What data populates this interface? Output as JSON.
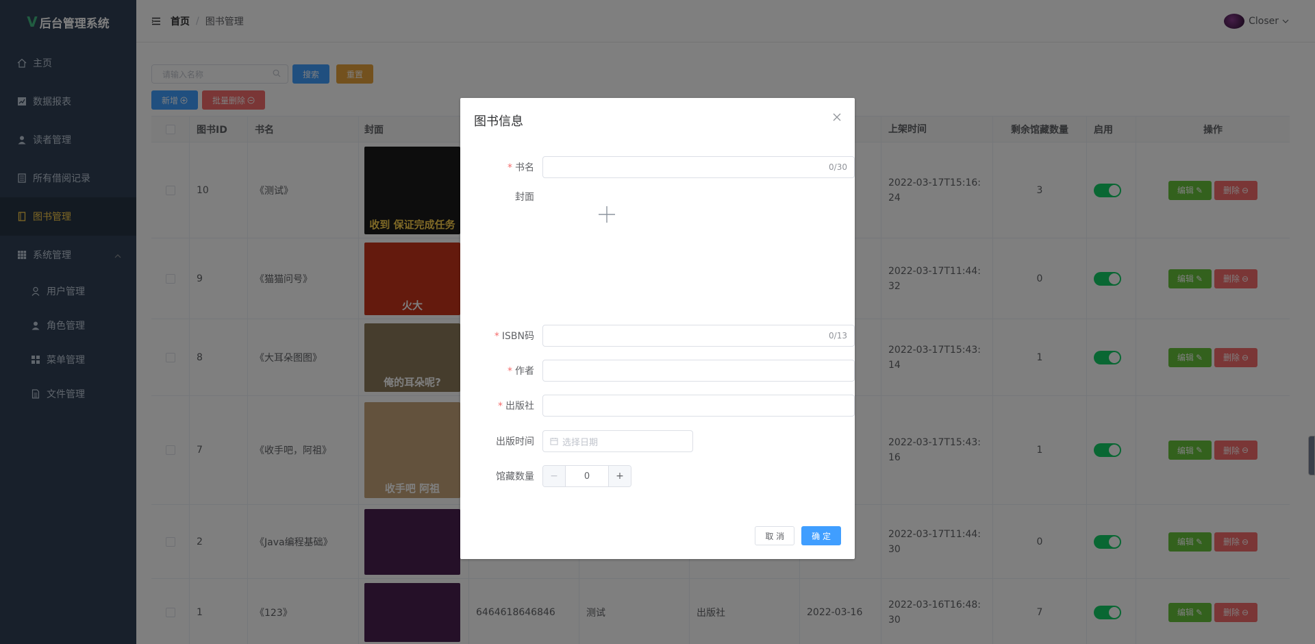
{
  "sidebar": {
    "logo": "后台管理系统",
    "items": [
      {
        "label": "主页",
        "icon": "home-icon"
      },
      {
        "label": "数据报表",
        "icon": "chart-icon"
      },
      {
        "label": "读者管理",
        "icon": "user-icon"
      },
      {
        "label": "所有借阅记录",
        "icon": "bank-icon"
      },
      {
        "label": "图书管理",
        "icon": "book-icon"
      },
      {
        "label": "系统管理",
        "icon": "grid-icon"
      }
    ],
    "subitems": [
      {
        "label": "用户管理",
        "icon": "user-icon"
      },
      {
        "label": "角色管理",
        "icon": "user-solid-icon"
      },
      {
        "label": "菜单管理",
        "icon": "menu-icon"
      },
      {
        "label": "文件管理",
        "icon": "document-icon"
      }
    ]
  },
  "header": {
    "breadcrumb_home": "首页",
    "breadcrumb_sep": "/",
    "breadcrumb_current": "图书管理",
    "username": "Closer"
  },
  "toolbar": {
    "search_placeholder": "请输入名称",
    "search_label": "搜索",
    "reset_label": "重置",
    "add_label": "新增",
    "batch_delete_label": "批量删除"
  },
  "table": {
    "headers": [
      "图书ID",
      "书名",
      "封面",
      "",
      "",
      "",
      "",
      "上架时间",
      "剩余馆藏数量",
      "启用",
      "操作"
    ],
    "rows": [
      {
        "id": "10",
        "name": "《测试》",
        "cover_text": "收到 保证完成任务",
        "isbn": "",
        "author": "",
        "publisher": "",
        "pubdate": "",
        "shelf": "2022-03-17T15:16:24",
        "remain": "3"
      },
      {
        "id": "9",
        "name": "《猫猫问号》",
        "cover_text": "火大",
        "isbn": "",
        "author": "",
        "publisher": "",
        "pubdate": "",
        "shelf": "2022-03-17T11:44:32",
        "remain": "0"
      },
      {
        "id": "8",
        "name": "《大耳朵图图》",
        "cover_text": "俺的耳朵呢?",
        "isbn": "",
        "author": "",
        "publisher": "",
        "pubdate": "",
        "shelf": "2022-03-17T15:43:14",
        "remain": "1"
      },
      {
        "id": "7",
        "name": "《收手吧，阿祖》",
        "cover_text": "收手吧 阿祖",
        "isbn": "",
        "author": "",
        "publisher": "",
        "pubdate": "",
        "shelf": "2022-03-17T15:43:16",
        "remain": "1"
      },
      {
        "id": "2",
        "name": "《Java编程基础》",
        "cover_text": "",
        "isbn": "",
        "author": "",
        "publisher": "",
        "pubdate": "",
        "shelf": "2022-03-17T11:44:30",
        "remain": "0"
      },
      {
        "id": "1",
        "name": "《123》",
        "cover_text": "",
        "isbn": "6464618646846",
        "author": "测试",
        "publisher": "出版社",
        "pubdate": "2022-03-16",
        "shelf": "2022-03-16T16:48:30",
        "remain": "7"
      }
    ],
    "edit_label": "编辑",
    "delete_label": "删除"
  },
  "dialog": {
    "title": "图书信息",
    "fields": {
      "name_label": "书名",
      "name_counter": "0/30",
      "cover_label": "封面",
      "isbn_label": "ISBN码",
      "isbn_counter": "0/13",
      "author_label": "作者",
      "publisher_label": "出版社",
      "pubdate_label": "出版时间",
      "pubdate_placeholder": "选择日期",
      "count_label": "馆藏数量",
      "count_value": "0",
      "required_mark": "*"
    },
    "cancel_label": "取 消",
    "confirm_label": "确 定"
  },
  "colors": {
    "sidebar": "#304156",
    "active": "#ffd04b",
    "primary": "#409eff",
    "danger": "#f56c6c",
    "success": "#67c23a",
    "warning": "#e6a23c"
  }
}
